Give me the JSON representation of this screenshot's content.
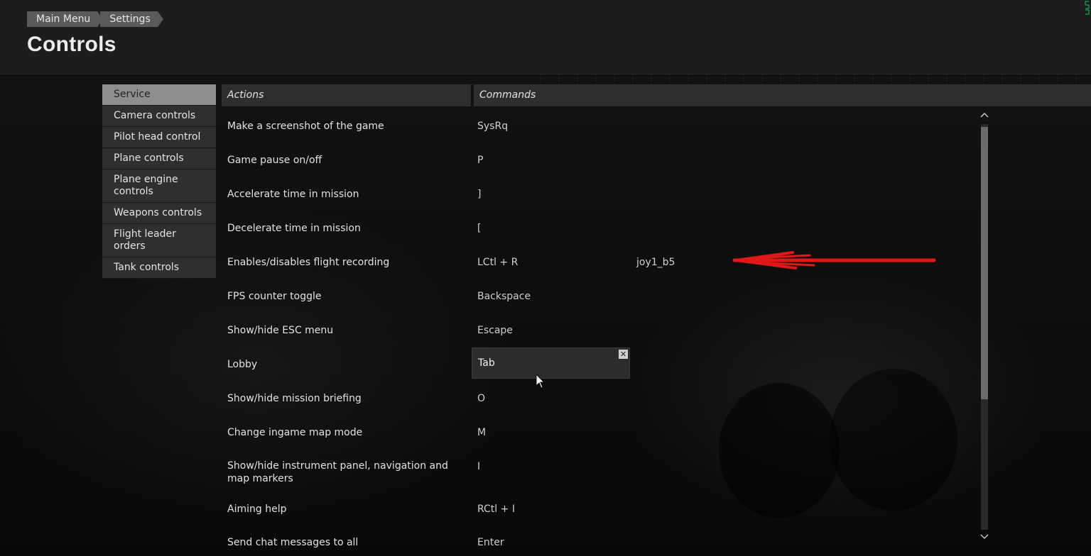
{
  "breadcrumb": {
    "items": [
      "Main Menu",
      "Settings"
    ]
  },
  "page": {
    "title": "Controls"
  },
  "sidebar": {
    "items": [
      {
        "label": "Service",
        "active": true
      },
      {
        "label": "Camera controls"
      },
      {
        "label": "Pilot head control"
      },
      {
        "label": "Plane controls"
      },
      {
        "label": "Plane engine controls"
      },
      {
        "label": "Weapons controls"
      },
      {
        "label": "Flight leader orders"
      },
      {
        "label": "Tank controls"
      }
    ]
  },
  "table": {
    "headers": {
      "actions": "Actions",
      "commands": "Commands"
    },
    "rows": [
      {
        "action": "Make a screenshot of the game",
        "cmd1": "SysRq",
        "cmd2": ""
      },
      {
        "action": "Game pause on/off",
        "cmd1": "P",
        "cmd2": ""
      },
      {
        "action": "Accelerate time in mission",
        "cmd1": "]",
        "cmd2": ""
      },
      {
        "action": "Decelerate time in mission",
        "cmd1": "[",
        "cmd2": ""
      },
      {
        "action": "Enables/disables flight recording",
        "cmd1": "LCtl + R",
        "cmd2": "joy1_b5"
      },
      {
        "action": "FPS counter toggle",
        "cmd1": "Backspace",
        "cmd2": ""
      },
      {
        "action": "Show/hide ESC menu",
        "cmd1": "Escape",
        "cmd2": ""
      },
      {
        "action": "Lobby",
        "cmd1": "Tab",
        "cmd2": ""
      },
      {
        "action": "Show/hide mission briefing",
        "cmd1": "O",
        "cmd2": ""
      },
      {
        "action": "Change ingame map mode",
        "cmd1": "M",
        "cmd2": ""
      },
      {
        "action": "Show/hide instrument panel, navigation and map markers",
        "cmd1": "I",
        "cmd2": ""
      },
      {
        "action": "Aiming help",
        "cmd1": "RCtl + I",
        "cmd2": ""
      },
      {
        "action": "Send chat messages to all",
        "cmd1": "Enter",
        "cmd2": ""
      }
    ]
  },
  "editor": {
    "value": "Tab"
  },
  "icons": {
    "close": "close-icon",
    "scroll_up": "chevron-up-icon",
    "scroll_down": "chevron-down-icon",
    "annotation": "red-arrow-annotation",
    "cursor": "mouse-cursor-icon"
  },
  "colors": {
    "annotation": "#e01818",
    "fps_counter": "#00d060"
  }
}
